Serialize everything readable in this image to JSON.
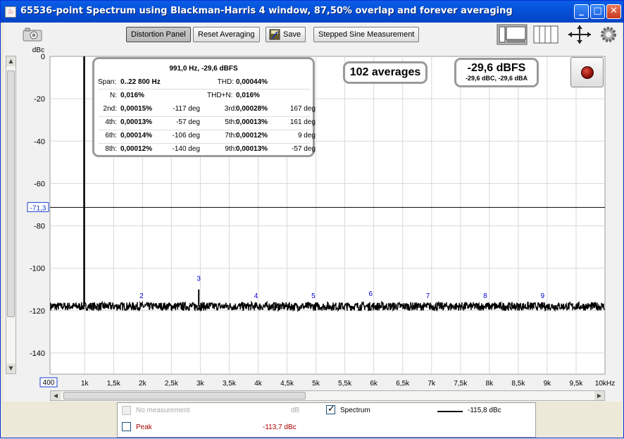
{
  "window": {
    "title": "65536-point Spectrum using Blackman-Harris 4 window, 87,50% overlap and forever averaging",
    "controls": {
      "minimize": "_",
      "maximize": "□",
      "close": "✕"
    }
  },
  "toolbar": {
    "distortion_panel": "Distortion Panel",
    "reset_averaging": "Reset Averaging",
    "save": "Save",
    "stepped_sine": "Stepped Sine Measurement"
  },
  "distortion": {
    "header": "991,0 Hz, -29,6 dBFS",
    "span_label": "Span:",
    "span_value": "0..22 800 Hz",
    "thd_label": "THD:",
    "thd_value": "0,00044%",
    "n_label": "N:",
    "n_value": "0,016%",
    "thdn_label": "THD+N:",
    "thdn_value": "0,016%",
    "harmonics": [
      {
        "label": "2nd:",
        "value": "0,00015%",
        "phase": "-117 deg"
      },
      {
        "label": "3rd:",
        "value": "0,00028%",
        "phase": "167 deg"
      },
      {
        "label": "4th:",
        "value": "0,00013%",
        "phase": "-57 deg"
      },
      {
        "label": "5th:",
        "value": "0,00013%",
        "phase": "161 deg"
      },
      {
        "label": "6th:",
        "value": "0,00014%",
        "phase": "-106 deg"
      },
      {
        "label": "7th:",
        "value": "0,00012%",
        "phase": "9 deg"
      },
      {
        "label": "8th:",
        "value": "0,00012%",
        "phase": "-140 deg"
      },
      {
        "label": "9th:",
        "value": "0,00013%",
        "phase": "-57 deg"
      }
    ]
  },
  "averages": "102 averages",
  "level": {
    "main": "-29,6 dBFS",
    "sub": "-29,6 dBC, -29,6 dBA"
  },
  "legend": {
    "no_measurement": "No measurement",
    "no_measurement_unit": "dB",
    "spectrum": "Spectrum",
    "spectrum_value": "-115,8 dBc",
    "peak": "Peak",
    "peak_value": "-113,7 dBc",
    "spectrum_checked": true,
    "peak_checked": false
  },
  "colors": {
    "trace": "#000000",
    "harmonic_label": "#0000cc",
    "peak_text": "#aa0000",
    "grid": "#d8d8d8"
  },
  "chart_data": {
    "type": "line",
    "ylabel": "dBc",
    "ylim": [
      -150,
      0
    ],
    "xlim": [
      400,
      10000
    ],
    "y_ticks": [
      0,
      -20,
      -40,
      -60,
      -80,
      -100,
      -120,
      -140
    ],
    "y_tick_labels": [
      "0",
      "-20",
      "-40",
      "-60",
      "-80",
      "-100",
      "-120",
      "-140"
    ],
    "x_ticks": [
      400,
      1000,
      1500,
      2000,
      2500,
      3000,
      3500,
      4000,
      4500,
      5000,
      5500,
      6000,
      6500,
      7000,
      7500,
      8000,
      8500,
      9000,
      9500,
      10000
    ],
    "x_tick_labels": [
      "400",
      "1k",
      "1,5k",
      "2k",
      "2,5k",
      "3k",
      "3,5k",
      "4k",
      "4,5k",
      "5k",
      "5,5k",
      "6k",
      "6,5k",
      "7k",
      "7,5k",
      "8k",
      "8,5k",
      "9k",
      "9,5k",
      "10kHz"
    ],
    "cursor_level": -71.3,
    "cursor_label": "-71,3",
    "noise_floor": -118,
    "fundamental": {
      "x": 991,
      "y": 0
    },
    "harmonics": [
      {
        "label": "2",
        "x": 1982,
        "y": -118
      },
      {
        "label": "3",
        "x": 2973,
        "y": -110
      },
      {
        "label": "4",
        "x": 3964,
        "y": -118
      },
      {
        "label": "5",
        "x": 4955,
        "y": -118
      },
      {
        "label": "6",
        "x": 5946,
        "y": -117
      },
      {
        "label": "7",
        "x": 6937,
        "y": -118
      },
      {
        "label": "8",
        "x": 7928,
        "y": -118
      },
      {
        "label": "9",
        "x": 8919,
        "y": -118
      }
    ],
    "series": [
      {
        "name": "Spectrum"
      }
    ],
    "grid": true
  }
}
